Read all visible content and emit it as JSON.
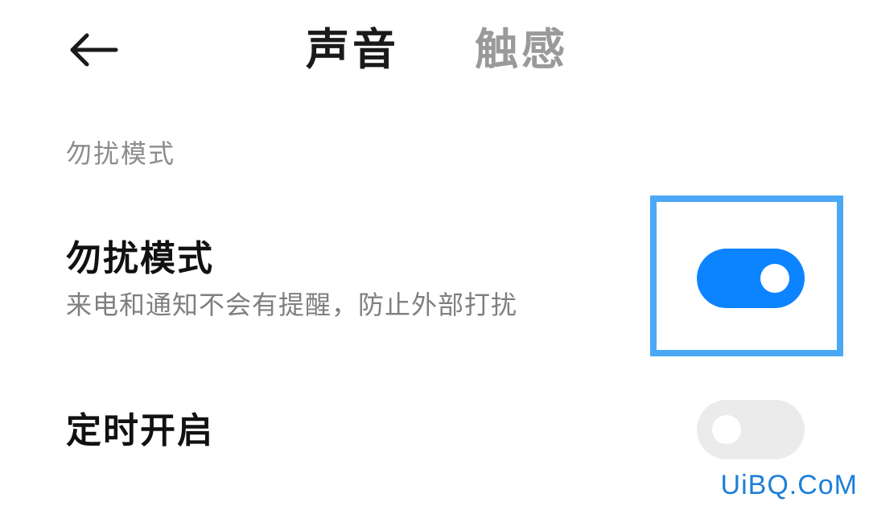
{
  "header": {
    "back_icon": "arrow-left-icon",
    "tabs": [
      {
        "label": "声音",
        "active": true
      },
      {
        "label": "触感",
        "active": false
      }
    ]
  },
  "section": {
    "label": "勿扰模式"
  },
  "settings": [
    {
      "title": "勿扰模式",
      "description": "来电和通知不会有提醒，防止外部打扰",
      "toggle_on": true
    },
    {
      "title": "定时开启",
      "toggle_on": false
    }
  ],
  "colors": {
    "toggle_on": "#0d84ff",
    "toggle_off": "#ebebeb",
    "highlight_border": "#4aa8f5",
    "inactive_tab": "#9a9a9a"
  },
  "watermark": "UiBQ.CoM"
}
